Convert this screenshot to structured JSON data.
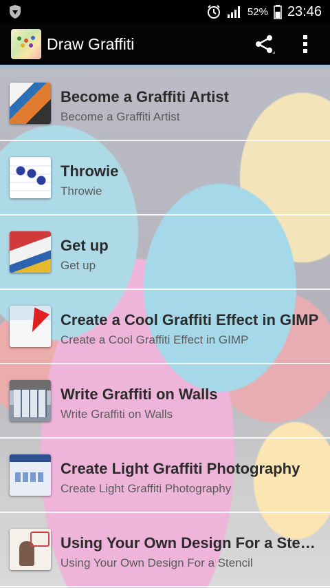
{
  "status_bar": {
    "battery_percent": "52%",
    "time": "23:46"
  },
  "app_bar": {
    "title": "Draw Graffiti",
    "share_icon": "share-icon",
    "overflow_icon": "more-vert-icon"
  },
  "items": [
    {
      "title": "Become a Graffiti Artist",
      "subtitle": "Become a Graffiti Artist"
    },
    {
      "title": "Throwie",
      "subtitle": "Throwie"
    },
    {
      "title": "Get up",
      "subtitle": "Get up"
    },
    {
      "title": "Create a Cool Graffiti Effect in GIMP",
      "subtitle": "Create a Cool Graffiti Effect in GIMP"
    },
    {
      "title": "Write Graffiti on Walls",
      "subtitle": "Write Graffiti on Walls"
    },
    {
      "title": "Create Light Graffiti Photography",
      "subtitle": "Create Light Graffiti Photography"
    },
    {
      "title": "Using Your Own Design For a Stencil",
      "subtitle": "Using Your Own Design For a Stencil"
    }
  ]
}
